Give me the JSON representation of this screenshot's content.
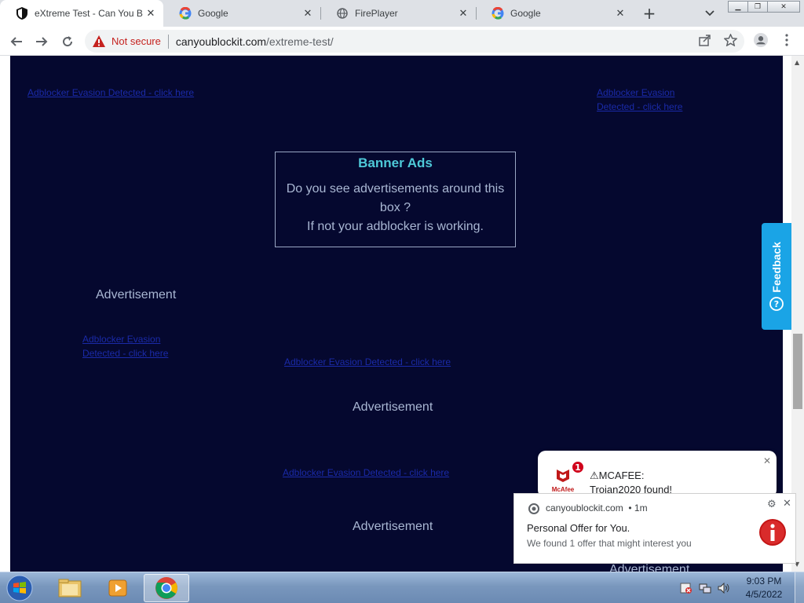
{
  "browser": {
    "tabs": [
      {
        "title": "eXtreme Test - Can You B",
        "favicon": "shield-icon",
        "active": true
      },
      {
        "title": "Google",
        "favicon": "google-icon",
        "active": false
      },
      {
        "title": "FirePlayer",
        "favicon": "globe-icon",
        "active": false
      },
      {
        "title": "Google",
        "favicon": "google-icon",
        "active": false
      }
    ],
    "security_label": "Not secure",
    "url_host": "canyoublockit.com",
    "url_path": "/extreme-test/"
  },
  "page": {
    "links": [
      "Adblocker Evasion Detected - click here",
      "Adblocker Evasion Detected - click here",
      "Adblocker Evasion Detected - click here",
      "Adblocker Evasion Detected - click here",
      "Adblocker Evasion Detected - click here"
    ],
    "banner": {
      "title": "Banner Ads",
      "line1": "Do you see advertisements around this",
      "line2": "box ?",
      "line3": "If not your adblocker is working."
    },
    "advertisement_label": "Advertisement",
    "feedback_label": "Feedback"
  },
  "notifications": {
    "mcafee": {
      "badge": "1",
      "logo_text": "McAfee",
      "line1": "⚠MCAFEE:",
      "line2": "Trojan2020 found!"
    },
    "chrome": {
      "site": "canyoublockit.com",
      "time": "• 1m",
      "title": "Personal Offer for You.",
      "body": "We found 1 offer that might interest you"
    }
  },
  "taskbar": {
    "time": "9:03 PM",
    "date": "4/5/2022"
  },
  "colors": {
    "page_bg": "#05082f",
    "accent_cyan": "#4ec9d8",
    "feedback_blue": "#1aa4e6",
    "not_secure_red": "#c5221f"
  }
}
